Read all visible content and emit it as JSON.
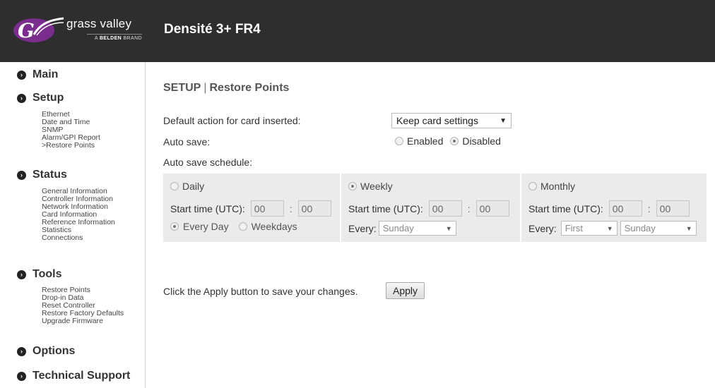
{
  "header": {
    "logo_brand": "grass valley",
    "logo_sub_prefix": "A ",
    "logo_sub_bold": "BELDEN",
    "logo_sub_suffix": " BRAND",
    "title": "Densité 3+ FR4"
  },
  "sidebar": {
    "main": "Main",
    "setup": {
      "label": "Setup",
      "items": [
        "Ethernet",
        "Date and Time",
        "SNMP",
        "Alarm/GPI Report",
        ">Restore Points"
      ]
    },
    "status": {
      "label": "Status",
      "items": [
        "General Information",
        "Controller Information",
        "Network Information",
        "Card Information",
        "Reference Information",
        "Statistics",
        "Connections"
      ]
    },
    "tools": {
      "label": "Tools",
      "items": [
        "Restore Points",
        "Drop-in Data",
        "Reset Controller",
        "Restore Factory Defaults",
        "Upgrade Firmware"
      ]
    },
    "options": "Options",
    "tech_support": "Technical Support"
  },
  "page": {
    "title_section": "SETUP",
    "title_sep": "|",
    "title_page": "Restore Points",
    "default_action_label": "Default action for card inserted:",
    "default_action_value": "Keep card settings",
    "auto_save_label": "Auto save:",
    "auto_save_enabled": "Enabled",
    "auto_save_disabled": "Disabled",
    "auto_save_selected": "Disabled",
    "schedule_label": "Auto save schedule:",
    "daily": {
      "label": "Daily",
      "start_label": "Start time (UTC):",
      "hour": "00",
      "minute": "00",
      "every_day": "Every Day",
      "weekdays": "Weekdays"
    },
    "weekly": {
      "label": "Weekly",
      "start_label": "Start time (UTC):",
      "hour": "00",
      "minute": "00",
      "every_label": "Every:",
      "day": "Sunday"
    },
    "monthly": {
      "label": "Monthly",
      "start_label": "Start time (UTC):",
      "hour": "00",
      "minute": "00",
      "every_label": "Every:",
      "ordinal": "First",
      "day": "Sunday"
    },
    "schedule_selected": "Weekly",
    "apply_text": "Click the Apply button to save your changes.",
    "apply_button": "Apply"
  }
}
